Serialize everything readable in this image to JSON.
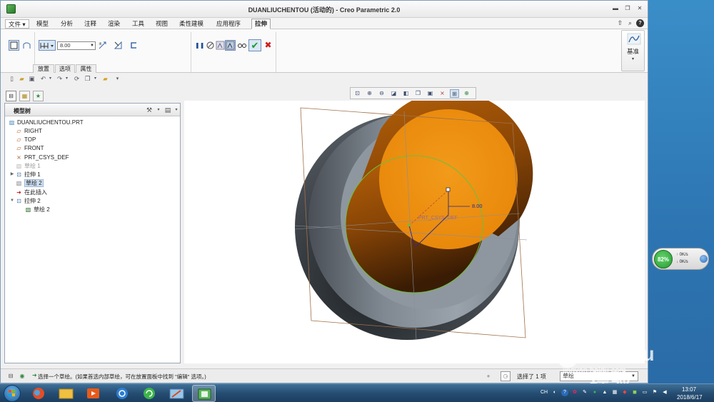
{
  "window": {
    "title": "DUANLIUCHENTOU (活动的) - Creo Parametric 2.0",
    "minimize": "▬",
    "restore": "❐",
    "close": "✕"
  },
  "menu": {
    "file": "文件 ▾",
    "tabs": [
      "模型",
      "分析",
      "注释",
      "渲染",
      "工具",
      "视图",
      "柔性建模",
      "应用程序"
    ],
    "active_tab": "拉伸"
  },
  "top_right_icons": [
    "up-arrow-icon",
    "search-icon",
    "help-icon"
  ],
  "ribbon": {
    "depth_value": "8.00",
    "subtabs": [
      "放置",
      "选项",
      "属性"
    ],
    "datum_label": "基准",
    "datum_menu": "▾",
    "pause_glyph": "❚❚",
    "ok_glyph": "✔",
    "cancel_glyph": "✖"
  },
  "tree": {
    "header": "模型树",
    "items": [
      {
        "label": "DUANLIUCHENTOU.PRT",
        "icon": "part-icon"
      },
      {
        "label": "RIGHT",
        "icon": "datum-plane-icon"
      },
      {
        "label": "TOP",
        "icon": "datum-plane-icon"
      },
      {
        "label": "FRONT",
        "icon": "datum-plane-icon"
      },
      {
        "label": "PRT_CSYS_DEF",
        "icon": "csys-icon"
      },
      {
        "label": "草绘 1",
        "icon": "sketch-icon"
      },
      {
        "label": "拉伸 1",
        "icon": "extrude-icon"
      },
      {
        "label": "草绘 2",
        "icon": "sketch-icon"
      },
      {
        "label": "在此插入",
        "icon": "insert-arrow-icon"
      },
      {
        "label": "拉伸 2",
        "icon": "extrude-icon"
      },
      {
        "label": "草绘 2",
        "icon": "sketch-icon"
      }
    ]
  },
  "graphics": {
    "dimension_label": "8.00",
    "csys_label": "PRT_CSYS_DEF",
    "colors": {
      "body": "#8c959e",
      "feature": "#ee8c0a",
      "feature_dark": "#7a3e05",
      "sketch": "#6fbf3c",
      "plane": "#a0714a",
      "dimension": "#2a2a8a"
    }
  },
  "status": {
    "message": "选择一个草绘。(如果首选内部草绘，可在放置面板中找到 \"编辑\" 选项。)",
    "selected": "选择了 1 项",
    "filter": "草绘"
  },
  "netmon": {
    "percent": "82%",
    "up": "0K/s",
    "down": "0K/s"
  },
  "watermark": {
    "logo": "Bai du 经验",
    "url": "jingyan.baidu.com"
  },
  "taskbar": {
    "lang": "CH",
    "time": "13:07",
    "date": "2018/6/17"
  }
}
